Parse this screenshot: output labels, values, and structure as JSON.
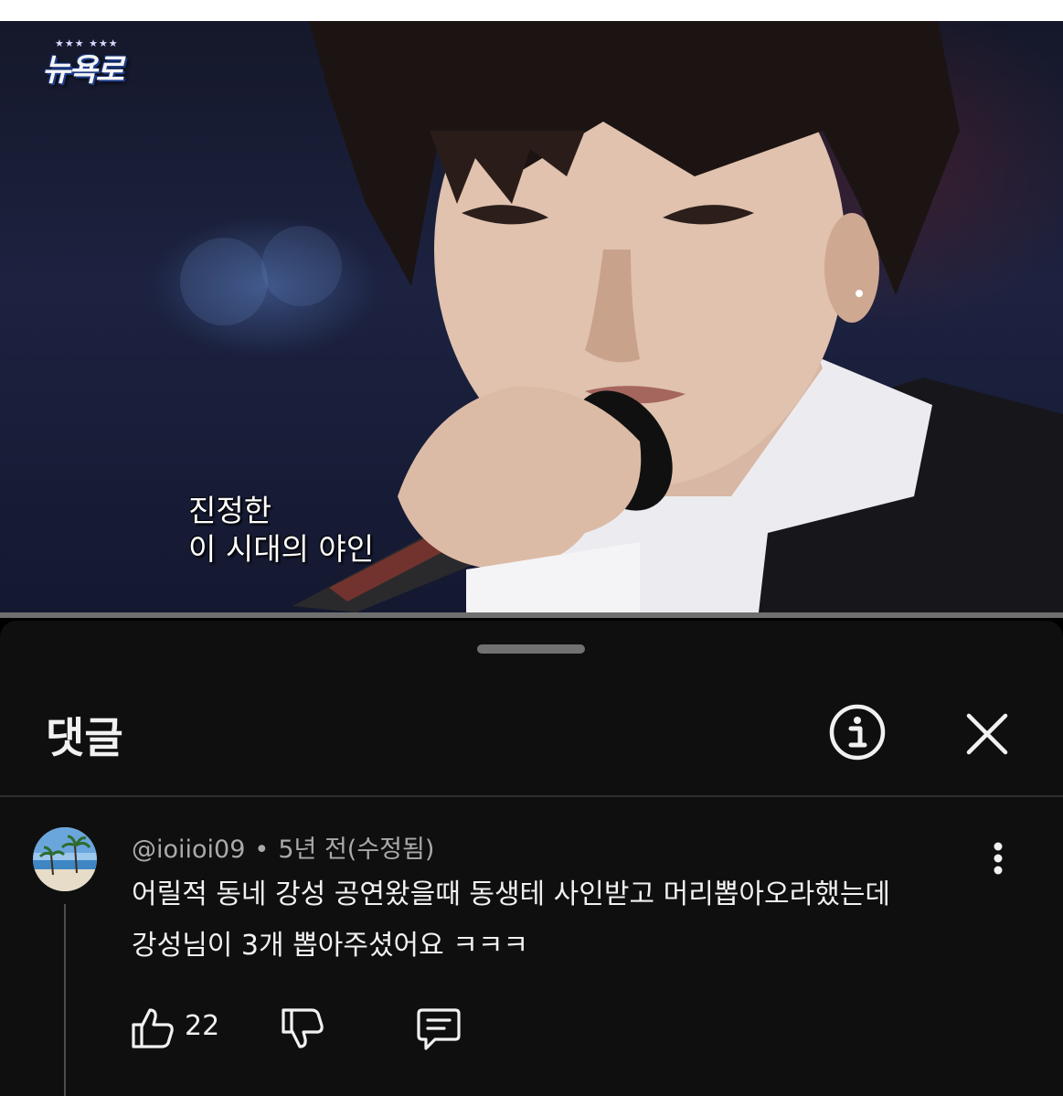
{
  "video": {
    "show_logo": "뉴욕로",
    "show_logo_stars": "★★★ ★★★",
    "caption_line1": "진정한",
    "caption_line2": "이 시대의 야인"
  },
  "comments_panel": {
    "title": "댓글",
    "info_icon": "info-circle-icon",
    "close_icon": "close-x-icon"
  },
  "comment": {
    "author": "@ioiioi09",
    "separator": "•",
    "time": "5년 전(수정됨)",
    "text_line1": "어릴적 동네 강성 공연왔을때 동생테 사인받고  머리뽑아오라했는데",
    "text_line2": "강성님이 3개 뽑아주셨어요 ㅋㅋㅋ",
    "like_count": "22",
    "icons": [
      "thumbs-up-icon",
      "thumbs-down-icon",
      "reply-icon",
      "more-vert-icon"
    ]
  },
  "colors": {
    "sheet_bg": "#0f0f0f",
    "text_primary": "#f1f1f1",
    "text_secondary": "#aaaaaa",
    "divider": "#2e2e2e"
  }
}
